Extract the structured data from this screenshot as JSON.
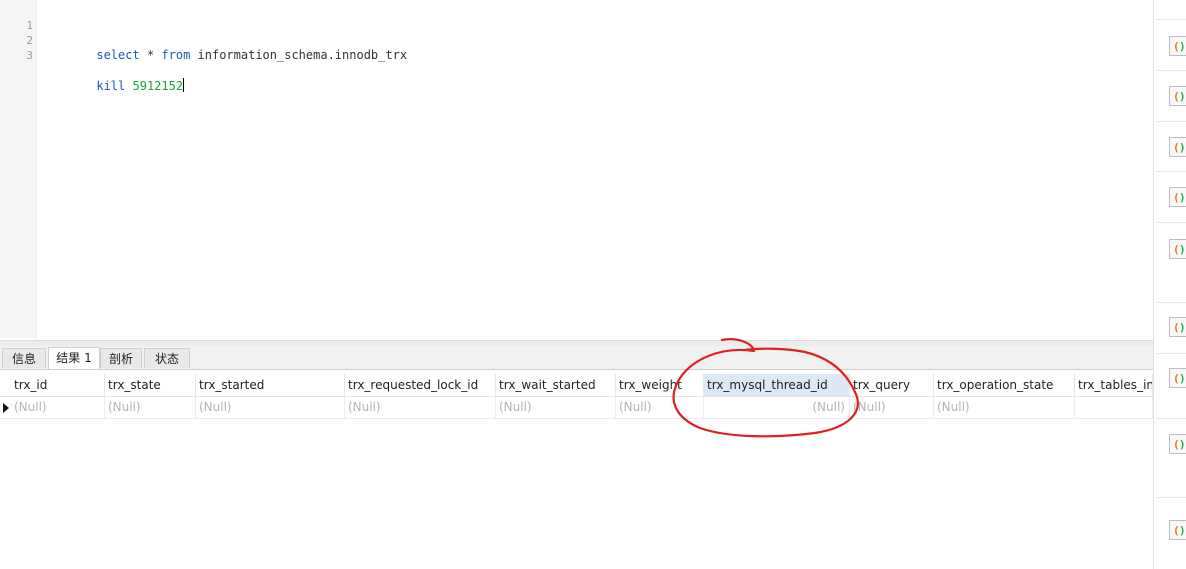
{
  "editor": {
    "lines": [
      {
        "num": "1",
        "keyword_select": "select",
        "op": " * ",
        "keyword_from": "from",
        "rest": " information_schema.innodb_trx"
      },
      {
        "num": "2"
      },
      {
        "num": "3",
        "keyword_kill": "kill",
        "value": "5912152"
      }
    ]
  },
  "tabs": [
    {
      "label": "信息"
    },
    {
      "label": "结果 1"
    },
    {
      "label": "剖析"
    },
    {
      "label": "状态"
    }
  ],
  "grid": {
    "columns": [
      "trx_id",
      "trx_state",
      "trx_started",
      "trx_requested_lock_id",
      "trx_wait_started",
      "trx_weight",
      "trx_mysql_thread_id",
      "trx_query",
      "trx_operation_state",
      "trx_tables_in_"
    ],
    "selected_column": "trx_mysql_thread_id",
    "rows": [
      [
        "(Null)",
        "(Null)",
        "(Null)",
        "(Null)",
        "(Null)",
        "(Null)",
        "(Null)",
        "(Null)",
        "(Null)",
        ""
      ]
    ]
  },
  "sidebar": {
    "icon": "snippet-braces-icon",
    "count": 9
  },
  "colors": {
    "keyword": "#1c57b8",
    "number": "#1aa33a",
    "null_text": "#b4b4b4",
    "annotation": "#e02020",
    "selected_header": "#dce8f6"
  }
}
